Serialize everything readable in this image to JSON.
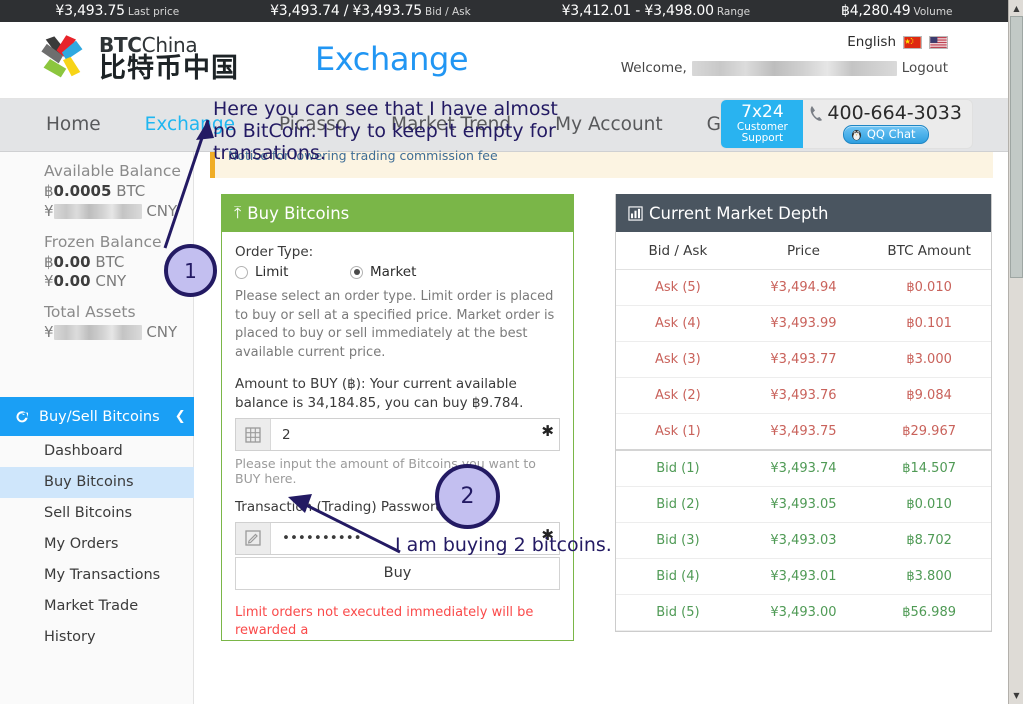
{
  "ticker": [
    {
      "value": "¥3,493.75",
      "label": "Last price"
    },
    {
      "value": "¥3,493.74 / ¥3,493.75",
      "label": "Bid / Ask"
    },
    {
      "value": "¥3,412.01 - ¥3,498.00",
      "label": "Range"
    },
    {
      "value": "฿4,280.49",
      "label": "Volume"
    }
  ],
  "header": {
    "logo_en_bold": "BTC",
    "logo_en_thin": "China",
    "logo_cn": "比特币中国",
    "page_title": "Exchange",
    "language": "English",
    "welcome": "Welcome,",
    "logout": "Logout",
    "support": {
      "badge_top": "7x24",
      "badge_line1": "Customer",
      "badge_line2": "Support",
      "phone": "400-664-3033",
      "qq_label": "QQ Chat"
    }
  },
  "nav": {
    "items": [
      {
        "label": "Home",
        "active": false
      },
      {
        "label": "Exchange",
        "active": true
      },
      {
        "label": "Picasso",
        "active": false
      },
      {
        "label": "Market Trend",
        "active": false
      },
      {
        "label": "My Account",
        "active": false
      },
      {
        "label": "Guide",
        "active": false
      }
    ]
  },
  "sidebar": {
    "available_balance": {
      "title": "Available Balance",
      "btc_symbol": "฿",
      "btc_value": "0.0005",
      "btc_unit": "BTC",
      "cny_symbol": "¥",
      "cny_value": "",
      "cny_unit": "CNY"
    },
    "frozen_balance": {
      "title": "Frozen Balance",
      "btc_symbol": "฿",
      "btc_value": "0.00",
      "btc_unit": "BTC",
      "cny_symbol": "¥",
      "cny_value": "0.00",
      "cny_unit": "CNY"
    },
    "total_assets": {
      "title": "Total Assets",
      "cny_symbol": "¥",
      "cny_value": "",
      "cny_unit": "CNY"
    },
    "menu_header": "Buy/Sell Bitcoins",
    "items": [
      {
        "label": "Dashboard",
        "selected": false
      },
      {
        "label": "Buy Bitcoins",
        "selected": true
      },
      {
        "label": "Sell Bitcoins",
        "selected": false
      },
      {
        "label": "My Orders",
        "selected": false
      },
      {
        "label": "My Transactions",
        "selected": false
      },
      {
        "label": "Market Trade History",
        "selected": false
      }
    ]
  },
  "notice": "Notice for lowering trading commission fee",
  "buy_panel": {
    "title": "Buy Bitcoins",
    "order_type_label": "Order Type:",
    "order_type_options": [
      {
        "label": "Limit",
        "selected": false
      },
      {
        "label": "Market",
        "selected": true
      }
    ],
    "order_type_help": "Please select an order type. Limit order is placed to buy or sell at a specified price. Market order is placed to buy or sell immediately at the best available current price.",
    "amount_label": "Amount to BUY (฿): Your current available balance is 34,184.85, you can buy ฿9.784.",
    "amount_value": "2",
    "amount_hint": "Please input the amount of Bitcoins you want to BUY here.",
    "password_label": "Transaction (Trading) Password:",
    "password_value": "••••••••••",
    "buy_button": "Buy",
    "limit_warning": "Limit orders not executed immediately will be rewarded a"
  },
  "market_depth": {
    "title": "Current Market Depth",
    "columns": [
      "Bid / Ask",
      "Price",
      "BTC Amount"
    ],
    "rows": [
      {
        "side": "ask",
        "label": "Ask (5)",
        "price": "¥3,494.94",
        "amount": "฿0.010"
      },
      {
        "side": "ask",
        "label": "Ask (4)",
        "price": "¥3,493.99",
        "amount": "฿0.101"
      },
      {
        "side": "ask",
        "label": "Ask (3)",
        "price": "¥3,493.77",
        "amount": "฿3.000"
      },
      {
        "side": "ask",
        "label": "Ask (2)",
        "price": "¥3,493.76",
        "amount": "฿9.084"
      },
      {
        "side": "ask",
        "label": "Ask (1)",
        "price": "¥3,493.75",
        "amount": "฿29.967",
        "separator": true
      },
      {
        "side": "bid",
        "label": "Bid (1)",
        "price": "¥3,493.74",
        "amount": "฿14.507"
      },
      {
        "side": "bid",
        "label": "Bid (2)",
        "price": "¥3,493.05",
        "amount": "฿0.010"
      },
      {
        "side": "bid",
        "label": "Bid (3)",
        "price": "¥3,493.03",
        "amount": "฿8.702"
      },
      {
        "side": "bid",
        "label": "Bid (4)",
        "price": "¥3,493.01",
        "amount": "฿3.800"
      },
      {
        "side": "bid",
        "label": "Bid (5)",
        "price": "¥3,493.00",
        "amount": "฿56.989"
      }
    ]
  },
  "annotations": {
    "note_1": "Here you can see that I have almost no BitCoin. I try to keep it empty for transations.",
    "note_2": "I am buying 2 bitcoins.",
    "marker_1": "1",
    "marker_2": "2"
  },
  "colors": {
    "accent_blue": "#1fb6f0",
    "buy_green": "#7ab648",
    "depth_header": "#4a5560",
    "ask_red": "#c9625b",
    "bid_green": "#4f9a55",
    "warning_red": "#fa4a4a",
    "annotation_navy": "#231a63"
  }
}
